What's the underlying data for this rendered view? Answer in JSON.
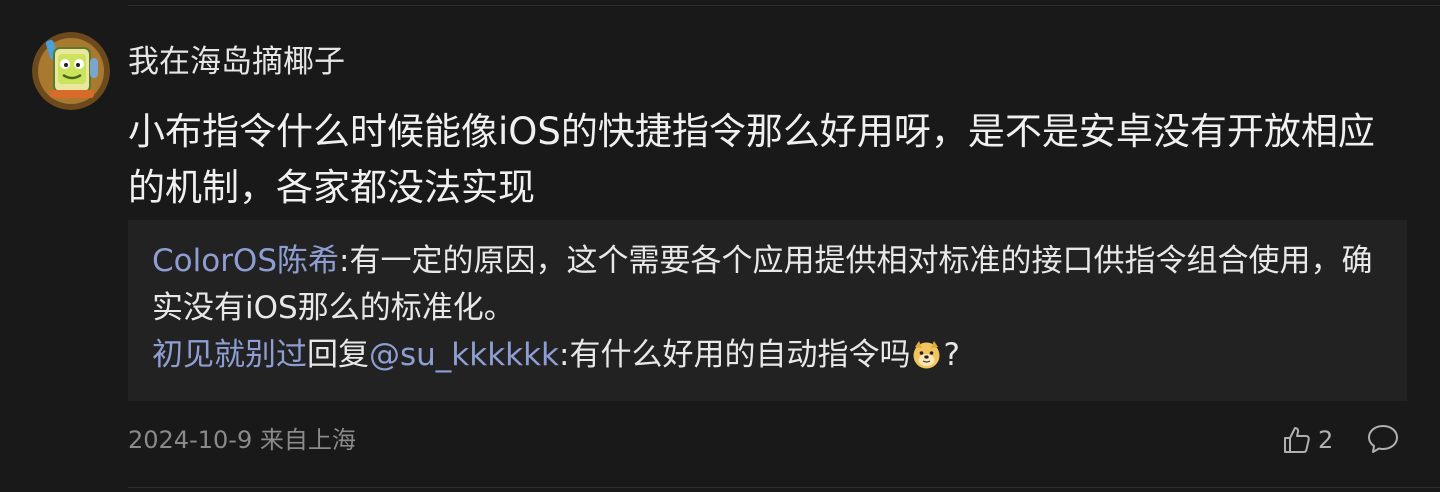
{
  "comment": {
    "avatar_icon": "lemonade-avatar-icon",
    "username": "我在海岛摘椰子",
    "text": "小布指令什么时候能像iOS的快捷指令那么好用呀，是不是安卓没有开放相应的机制，各家都没法实现"
  },
  "replies": [
    {
      "author": "ColorOS陈希",
      "separator": ":",
      "text": "有一定的原因，这个需要各个应用提供相对标准的接口供指令组合使用，确实没有iOS那么的标准化。"
    },
    {
      "author": "初见就别过",
      "reply_word": "回复",
      "mention": "@su_kkkkkk",
      "separator": ":",
      "text": "有什么好用的自动指令吗",
      "emoji": "doge-emoji",
      "trailing": "?"
    }
  ],
  "meta": {
    "date_location": "2024-10-9 来自上海"
  },
  "actions": {
    "like_icon": "thumbs-up-icon",
    "like_count": "2",
    "reply_icon": "comment-bubble-icon"
  },
  "colors": {
    "background": "#191919",
    "reply_background": "#222223",
    "link": "#8f9ed2",
    "text": "#f0f0f0",
    "meta": "#8a8a8a"
  }
}
